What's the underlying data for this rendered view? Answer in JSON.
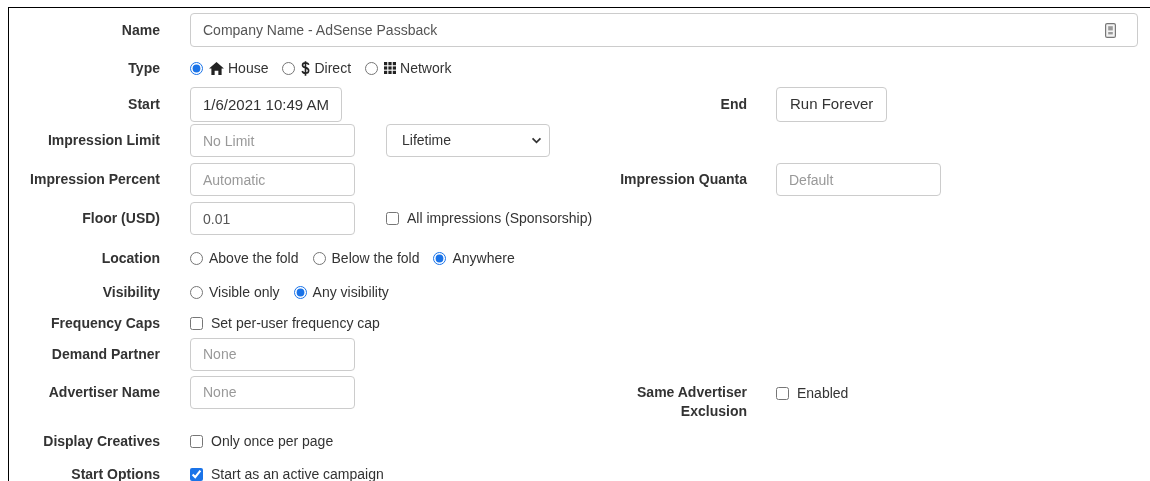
{
  "rows": [
    {
      "label": "Name",
      "control": {
        "kind": "name_input",
        "value": "Company Name - AdSense Passback"
      }
    },
    {
      "label": "Type",
      "control": {
        "kind": "type_radios",
        "options": [
          {
            "label": "House",
            "selected": true
          },
          {
            "label": "Direct",
            "selected": false
          },
          {
            "label": "Network",
            "selected": false
          }
        ]
      }
    },
    {
      "label": "Start",
      "control": {
        "kind": "datetime",
        "value": "1/6/2021 10:49 AM"
      },
      "right": {
        "label": "End",
        "control": {
          "kind": "button",
          "label": "Run Forever"
        }
      }
    },
    {
      "label": "Impression Limit",
      "control": {
        "kind": "input",
        "placeholder": "No Limit"
      },
      "extra": {
        "kind": "select",
        "value": "Lifetime"
      }
    },
    {
      "label": "Impression Percent",
      "control": {
        "kind": "input",
        "placeholder": "Automatic"
      },
      "right": {
        "label": "Impression Quanta",
        "control": {
          "kind": "input",
          "placeholder": "Default"
        }
      }
    },
    {
      "label": "Floor (USD)",
      "control": {
        "kind": "input",
        "value": "0.01"
      },
      "extra": {
        "kind": "checkbox",
        "label": "All impressions (Sponsorship)",
        "checked": false
      }
    },
    {
      "label": "Location",
      "control": {
        "kind": "radios",
        "options": [
          {
            "label": "Above the fold",
            "selected": false
          },
          {
            "label": "Below the fold",
            "selected": false
          },
          {
            "label": "Anywhere",
            "selected": true
          }
        ]
      }
    },
    {
      "label": "Visibility",
      "control": {
        "kind": "radios",
        "options": [
          {
            "label": "Visible only",
            "selected": false
          },
          {
            "label": "Any visibility",
            "selected": true
          }
        ]
      }
    },
    {
      "label": "Frequency Caps",
      "control": {
        "kind": "checkbox",
        "label": "Set per-user frequency cap",
        "checked": false
      }
    },
    {
      "label": "Demand Partner",
      "control": {
        "kind": "input",
        "placeholder": "None"
      }
    },
    {
      "label": "Advertiser Name",
      "control": {
        "kind": "input",
        "placeholder": "None"
      },
      "right": {
        "label": "Same Advertiser Exclusion",
        "control": {
          "kind": "checkbox",
          "label": "Enabled",
          "checked": false
        }
      }
    },
    {
      "label": "Display Creatives",
      "control": {
        "kind": "checkbox",
        "label": "Only once per page",
        "checked": false
      }
    },
    {
      "label": "Start Options",
      "control": {
        "kind": "checkbox",
        "label": "Start as an active campaign",
        "checked": true
      }
    }
  ]
}
